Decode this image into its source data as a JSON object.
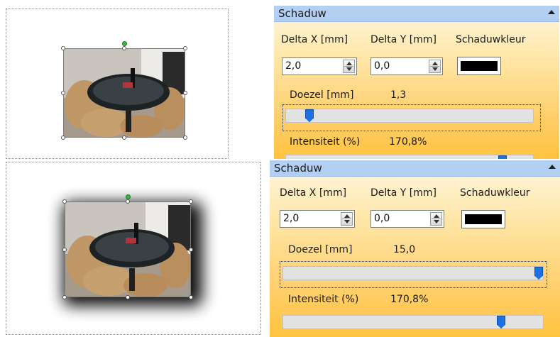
{
  "panels": [
    {
      "id": "top",
      "title": "Schaduw",
      "delta_x_label": "Delta X [mm]",
      "delta_y_label": "Delta Y [mm]",
      "color_label": "Schaduwkleur",
      "delta_x_value": "2,0",
      "delta_y_value": "0,0",
      "shadow_color": "#000000",
      "blur_label": "Doezel [mm]",
      "blur_value": "1,3",
      "blur_level_percent": 8,
      "intensity_label": "Intensiteit (%)",
      "intensity_value": "170,8%",
      "intensity_level_percent": 89
    },
    {
      "id": "bottom",
      "title": "Schaduw",
      "delta_x_label": "Delta X [mm]",
      "delta_y_label": "Delta Y [mm]",
      "color_label": "Schaduwkleur",
      "delta_x_value": "2,0",
      "delta_y_value": "0,0",
      "shadow_color": "#000000",
      "blur_label": "Doezel [mm]",
      "blur_value": "15,0",
      "blur_level_percent": 100,
      "intensity_label": "Intensiteit (%)",
      "intensity_value": "170,8%",
      "intensity_level_percent": 85
    }
  ],
  "canvases": [
    {
      "id": "top",
      "shadow": false
    },
    {
      "id": "bottom",
      "shadow": true
    }
  ],
  "colors": {
    "panel_header": "#b3cff2",
    "panel_gradient_end": "#ffc33f",
    "slider_thumb": "#1e6fe0",
    "rotation_handle": "#2fbf3c"
  },
  "icons": [
    "collapse-arrow-icon",
    "spin-up-icon",
    "spin-down-icon",
    "rotation-handle-icon",
    "resize-handle-icon"
  ]
}
